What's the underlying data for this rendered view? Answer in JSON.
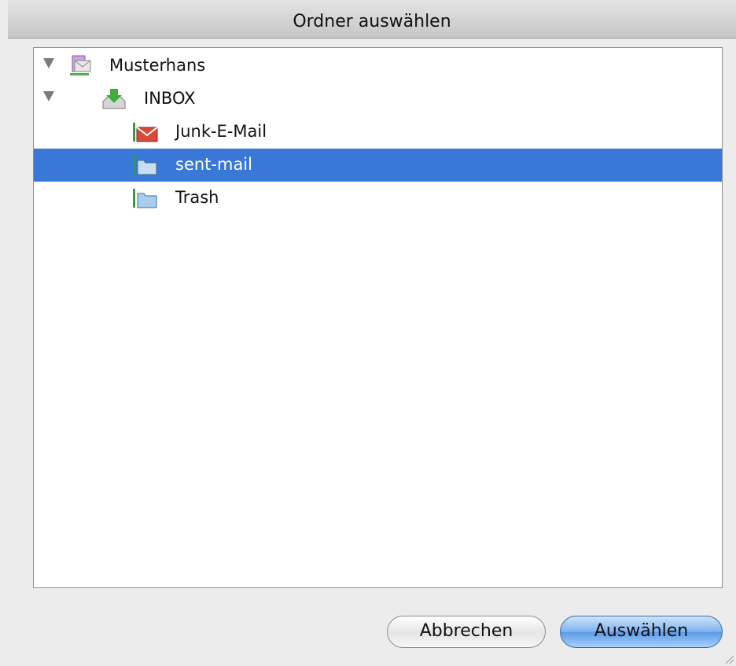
{
  "dialog": {
    "title": "Ordner auswählen"
  },
  "tree": {
    "account": {
      "label": "Musterhans",
      "icon": "account-icon",
      "expanded": true
    },
    "inbox": {
      "label": "INBOX",
      "icon": "inbox-icon",
      "expanded": true
    },
    "folders": [
      {
        "label": "Junk-E-Mail",
        "icon": "junk-mail-icon",
        "selected": false
      },
      {
        "label": "sent-mail",
        "icon": "folder-icon",
        "selected": true
      },
      {
        "label": "Trash",
        "icon": "folder-icon",
        "selected": false
      }
    ]
  },
  "buttons": {
    "cancel_label": "Abbrechen",
    "select_label": "Auswählen"
  },
  "colors": {
    "selection": "#3978d6",
    "default_button": "#6aa6ea"
  }
}
